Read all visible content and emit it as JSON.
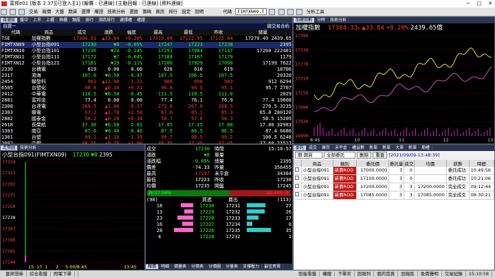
{
  "window": {
    "title": "富邦e01 [版本 2.37][已登入][1] [報價 : 已連線] [主動回報 : 已連線] [資料連線]"
  },
  "menu": [
    "交易",
    "報價",
    "大盤",
    "期貨",
    "選擇",
    "權證",
    "技術分析",
    "選股",
    "籌碼",
    "資訊",
    "排行",
    "設定",
    "說明"
  ],
  "toolbar": {
    "code_label": "代碼",
    "code_value": "FIMTXN09.T",
    "analysis": "分析工具"
  },
  "quote_panel": {
    "tabs": [
      "自選股",
      "盤中",
      "上市",
      "上櫃",
      "興櫃",
      "類股",
      "排行",
      "漲跌排行",
      "選擇權",
      "權證"
    ],
    "sub_title": "自選一",
    "menu_label": "總交易合約",
    "headers": [
      "代碼",
      "商品",
      "成交",
      "漲跌",
      "幅度",
      "最高",
      "最低",
      "昨收",
      "總量"
    ],
    "rows": [
      {
        "code": "TSE",
        "name": "加權指數",
        "price": "17304.33",
        "chg": "▲33.84",
        "pct": "+0.20%",
        "high": "17319.09",
        "low": "17122.95",
        "prev": "17175.04",
        "vol": "17270.49",
        "vol2": "2439.65",
        "cls": "red"
      },
      {
        "code": "FIMTXN09",
        "name": "小型台指091",
        "price": "17230",
        "chg": "▼8",
        "pct": "-0.05%",
        "high": "17247",
        "low": "17223",
        "prev": "17238",
        "vol": "2395",
        "cls": "green"
      },
      {
        "code": "FIMTXN10",
        "name": "小型台指101",
        "price": "17236",
        "chg": "▼24",
        "pct": "-0.14%",
        "high": "17291",
        "low": "17084",
        "prev": "17147",
        "vol": "17260",
        "vol2": "222401",
        "cls": "green"
      },
      {
        "code": "FIMTXN11",
        "name": "小型台指111",
        "price": "17172",
        "chg": "▼7",
        "pct": "-0.04%",
        "high": "17188",
        "low": "17167",
        "prev": "17179",
        "vol": "1179",
        "cls": "green"
      },
      {
        "code": "FIMTXN12",
        "name": "小型台指121",
        "price": "17181",
        "chg": "▼19",
        "pct": "-0.11%",
        "high": "17200",
        "low": "17029",
        "prev": "17090",
        "vol": "17199",
        "vol2": "7622",
        "cls": "green"
      },
      {
        "code": "2330",
        "name": "台積電",
        "price": "619",
        "chg": "0.00",
        "pct": "0.00",
        "high": "626",
        "low": "610",
        "prev": "619",
        "vol": "18706",
        "cls": "white"
      },
      {
        "code": "2317",
        "name": "鴻海",
        "price": "107.0",
        "chg": "▼0.50",
        "pct": "-0.47",
        "high": "107.5",
        "low": "106.5",
        "prev": "107.5",
        "vol": "20320",
        "cls": "green"
      },
      {
        "code": "2454",
        "name": "聯發科",
        "price": "901",
        "chg": "▲11.00",
        "pct": "-1.21",
        "high": "908",
        "low": "898",
        "prev": "903",
        "vol": "912",
        "vol2": "6294",
        "cls": "red"
      },
      {
        "code": "6505",
        "name": "台塑化",
        "price": "96.8",
        "chg": "▲0.30",
        "pct": "+0.31",
        "high": "96.8",
        "low": "94.5",
        "prev": "95.1",
        "vol": "95.7",
        "vol2": "2707",
        "cls": "red"
      },
      {
        "code": "2412",
        "name": "中華電",
        "price": "110.5",
        "chg": "▼0.50",
        "pct": "-0.45",
        "high": "111.5",
        "low": "110.5",
        "prev": "111.0",
        "vol": "2029",
        "cls": "green"
      },
      {
        "code": "2881",
        "name": "富邦金",
        "price": "77.4",
        "chg": "0.00",
        "pct": "0.00",
        "high": "77.4",
        "low": "76.1",
        "prev": "76.9",
        "vol": "77.4",
        "vol2": "19808",
        "cls": "white"
      },
      {
        "code": "2308",
        "name": "台達電",
        "price": "269.5",
        "chg": "▲1.00",
        "pct": "-0.37",
        "high": "272.0",
        "low": "267.0",
        "prev": "268.5",
        "vol": "270.5",
        "vol2": "3235",
        "cls": "red"
      },
      {
        "code": "2303",
        "name": "聯電",
        "price": "67.2",
        "chg": "▲1.70",
        "pct": "+2.58",
        "high": "67.6",
        "low": "65.1",
        "prev": "65.3",
        "vol": "65.8",
        "vol2": "280120",
        "cls": "red"
      },
      {
        "code": "2882",
        "name": "國泰金",
        "price": "58.2",
        "chg": "▲0.20",
        "pct": "+0.34",
        "high": "58.7",
        "low": "57.8",
        "prev": "58.3",
        "vol": "58.5",
        "vol2": "15209",
        "cls": "red"
      },
      {
        "code": "2618",
        "name": "長榮航",
        "price": "17.30",
        "chg": "▼0.50",
        "pct": "-2.81",
        "high": "17.85",
        "low": "17.25",
        "prev": "17.80",
        "vol": "17.80",
        "vol2": "32983",
        "cls": "green"
      },
      {
        "code": "1303",
        "name": "南亞",
        "price": "87.0",
        "chg": "▼0.40",
        "pct": "-0.46",
        "high": "87.5",
        "low": "86.5",
        "prev": "86.5",
        "vol": "87.4",
        "vol2": "6686",
        "cls": "green"
      },
      {
        "code": "1301",
        "name": "台塑",
        "price": "99.1",
        "chg": "▲1.10",
        "pct": "-1.39",
        "high": "99.7",
        "low": "98.5",
        "prev": "99.2",
        "vol": "100.5",
        "vol2": "6248",
        "cls": "red"
      },
      {
        "code": "2002",
        "name": "中鋼",
        "price": "38.35",
        "chg": "▲0.75",
        "pct": "+1.99",
        "high": "38.35",
        "low": "37.35",
        "prev": "37.45",
        "vol": "37.60",
        "vol2": "71512",
        "cls": "red"
      }
    ]
  },
  "index_panel": {
    "tabs": [
      "加權指數",
      "分時",
      "技術分析"
    ],
    "title": "加權指數",
    "price": "17304.33",
    "unit": "s",
    "chg": "▲33.84",
    "pct": "+0.20%",
    "amount": "2439.65億",
    "y_ticks": [
      "17390",
      "17330",
      "17270",
      "17210",
      "17150",
      "17090",
      "17030",
      "16990"
    ],
    "x_ticks": [
      "8:45",
      "10",
      "11",
      "12",
      "13:35"
    ]
  },
  "tick_panel": {
    "tabs": [
      "走勢圖",
      "技術分析"
    ],
    "title": "小型台指091(FIMTXN09)",
    "price": "17230",
    "chg": "▼8",
    "vol": "2395",
    "y_ticks": [
      "17334",
      "17313",
      "17292",
      "17271",
      "17250",
      "17238",
      "17207",
      "17186",
      "17165",
      "17144"
    ],
    "x_ticks": [
      "15",
      "17",
      "1",
      "2",
      "5:00/8:45",
      "13:45"
    ]
  },
  "detail_panel": {
    "rows": [
      {
        "label": "成交",
        "value": "17230",
        "cls": "green",
        "label2": "時間",
        "value2": "15:10:57"
      },
      {
        "label": "漲跌",
        "value": "▼8",
        "cls": "green",
        "label2": "單量",
        "value2": ""
      },
      {
        "label": "漲跌幅",
        "value": "-0.05%",
        "cls": "green",
        "label2": "總量",
        "value2": "2395"
      },
      {
        "label": "價差",
        "value": "-74.33",
        "cls": "white",
        "label2": "昨量",
        "value2": "356455"
      },
      {
        "label": "最高",
        "value": "17247",
        "cls": "red",
        "label2": "未平倉",
        "value2": "34384"
      },
      {
        "label": "最低",
        "value": "17223",
        "cls": "white",
        "label2": "昨收",
        "value2": "17238"
      },
      {
        "label": "均價",
        "value": "17235",
        "cls": "white",
        "label2": "開盤",
        "value2": "17245"
      }
    ],
    "inner_pct": "內 57.56%",
    "outer_pct": "42.44% 外",
    "bid_total": "(98)",
    "ask_total": "(113)",
    "bid_label": "買進",
    "ask_label": "賣出",
    "book": [
      {
        "bq": "18",
        "bp": "17230",
        "ap": "17231",
        "aq": "27"
      },
      {
        "bq": "13",
        "bp": "17229",
        "ap": "17232",
        "aq": "26"
      },
      {
        "bq": "23",
        "bp": "17228",
        "ap": "17233",
        "aq": "17"
      },
      {
        "bq": "16",
        "bp": "17227",
        "ap": "17234",
        "aq": "8"
      },
      {
        "bq": "28",
        "bp": "17226",
        "ap": "17235",
        "aq": "35"
      }
    ],
    "last_row": {
      "bq": "4",
      "bp": "17228",
      "ap": "17232",
      "aq": "1"
    },
    "bottom_tabs": [
      "報價",
      "明細",
      "價量表",
      "分價表",
      "分價圖",
      "分量表",
      "支撐壓力",
      "最佳買賣"
    ]
  },
  "orders_panel": {
    "tabs": [
      "委託",
      "成交",
      "庫存",
      "未平倉",
      "權益數",
      "新單",
      "新單",
      "大單",
      "新單",
      "期權"
    ],
    "account": "期 期貨",
    "filter": "全部委託",
    "delete_btn": "刪除",
    "refresh_btn": "重查",
    "timestamp": "[2021/09/09-13:48:39]",
    "headers": [
      "",
      "商品",
      "類別",
      "委託價",
      "委託量",
      "成交",
      "均價",
      "狀態",
      "時間"
    ],
    "rows": [
      {
        "name": "小型台指091",
        "type": "新賣ROD",
        "price": "17000.0000",
        "qty": "3",
        "fill": "0",
        "avg": "",
        "status": "委託成功",
        "time": "10:49:56"
      },
      {
        "name": "小型台指091",
        "type": "新賣ROD",
        "price": "17100.0000",
        "qty": "3",
        "fill": "0",
        "avg": "",
        "status": "委託成功",
        "time": "10:21:06"
      },
      {
        "name": "小型台指091",
        "type": "新賣ROD",
        "price": "17200.0000",
        "qty": "3",
        "fill": "3",
        "avg": "17200.0000",
        "status": "完全成交",
        "time": "09:12:44"
      },
      {
        "name": "小型台指091",
        "type": "新賣ROD",
        "price": "17085.0000",
        "qty": "3",
        "fill": "3",
        "avg": "17085.0000",
        "status": "完全成交",
        "time": "08:30:21"
      }
    ]
  },
  "status_bar": {
    "left": [
      "富邦證券",
      "綜合看盤",
      "閃電下單"
    ],
    "right": [
      "智能看盤",
      "權服",
      "下單夾",
      "回報列",
      "我的首頁",
      "回報區",
      "免責聲明",
      "交易紀錄",
      "15:10:58"
    ]
  },
  "colors": {
    "up": "#ff3b3b",
    "down": "#2cff2c",
    "bg": "#000000",
    "line": "#ffff33",
    "avg": "#ff66ff"
  }
}
